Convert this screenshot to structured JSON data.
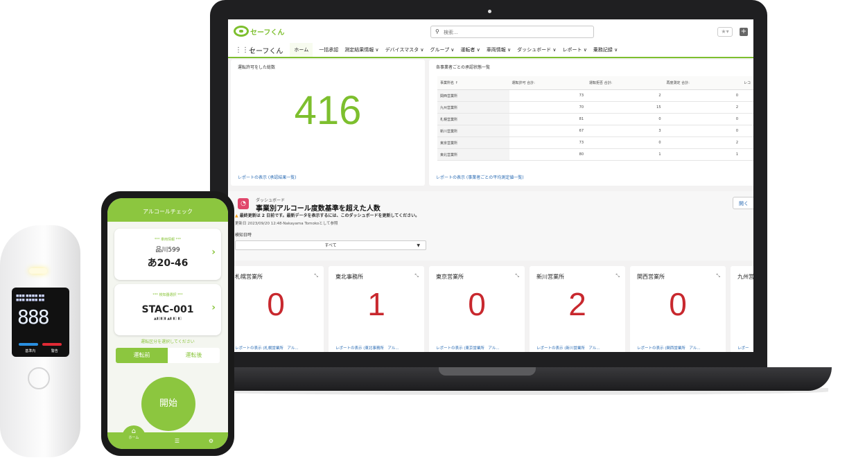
{
  "app": {
    "logo_text": "セーフくん",
    "search_placeholder": "検索...",
    "nav": {
      "app_name": "セーフくん",
      "items": [
        "ホーム",
        "一括承認",
        "測定結果情報 ∨",
        "デバイスマスタ ∨",
        "グループ ∨",
        "運転者 ∨",
        "車両情報 ∨",
        "ダッシュボード ∨",
        "レポート ∨",
        "乗務記録 ∨"
      ]
    }
  },
  "total_card": {
    "title": "運転許可をした総数",
    "value": "416",
    "link": "レポートの表示 (承認結果一覧)"
  },
  "approval_card": {
    "title": "各事業者ごとの承認状態一覧",
    "columns": [
      "事業所名 ↑",
      "運転許可 合計:",
      "運転拒否 合計:",
      "再度測定 合計:",
      "レコ"
    ],
    "rows": [
      [
        "関西営業所",
        "73",
        "2",
        "0"
      ],
      [
        "九州営業所",
        "70",
        "15",
        "2"
      ],
      [
        "札幌営業所",
        "81",
        "0",
        "0"
      ],
      [
        "新川営業所",
        "67",
        "3",
        "0"
      ],
      [
        "東京営業所",
        "73",
        "0",
        "2"
      ],
      [
        "東北営業所",
        "80",
        "1",
        "1"
      ]
    ],
    "link": "レポートの表示 (事業者ごとの平均測定値一覧)"
  },
  "dashboard": {
    "subtitle": "ダッシュボード",
    "title": "事業別アルコール度数基準を超えた人数",
    "warning": "最終更新は 2 日前です。最新データを表示するには、このダッシュボードを更新してください。",
    "updated": "更新日 2023/09/20 12:48·Nakayama Tomokoとして参照",
    "filter_label": "検知日時",
    "filter_value": "すべて",
    "open_button": "開く",
    "tiles": [
      {
        "name": "札幌営業所",
        "value": "0",
        "link": "レポートの表示 (札幌営業所　アル..."
      },
      {
        "name": "東北事務所",
        "value": "1",
        "link": "レポートの表示 (東北事務所　アル..."
      },
      {
        "name": "東京営業所",
        "value": "0",
        "link": "レポートの表示 (東京営業所　アル..."
      },
      {
        "name": "新川営業所",
        "value": "2",
        "link": "レポートの表示 (新川営業所　アル..."
      },
      {
        "name": "関西営業所",
        "value": "0",
        "link": "レポートの表示 (関西営業所　アル..."
      },
      {
        "name": "九州営",
        "value": "",
        "link": "レポー"
      }
    ]
  },
  "device": {
    "reading": "888",
    "labels": [
      "基準内",
      "警告"
    ]
  },
  "phone": {
    "title": "アルコールチェック",
    "vehicle_label": "*** 車両情報 ***",
    "vehicle_line1": "品川599",
    "vehicle_line2": "あ20-46",
    "detector_label": "*** 検知器選択 ***",
    "detector_id": "STAC-001",
    "mode_prompt": "運転区分を選択してください",
    "mode_before": "運転前",
    "mode_after": "運転後",
    "start": "開始",
    "home_label": "ホーム"
  },
  "colors": {
    "brand": "#8cc63f",
    "alert": "#c8282e",
    "link": "#2a6bb3"
  }
}
